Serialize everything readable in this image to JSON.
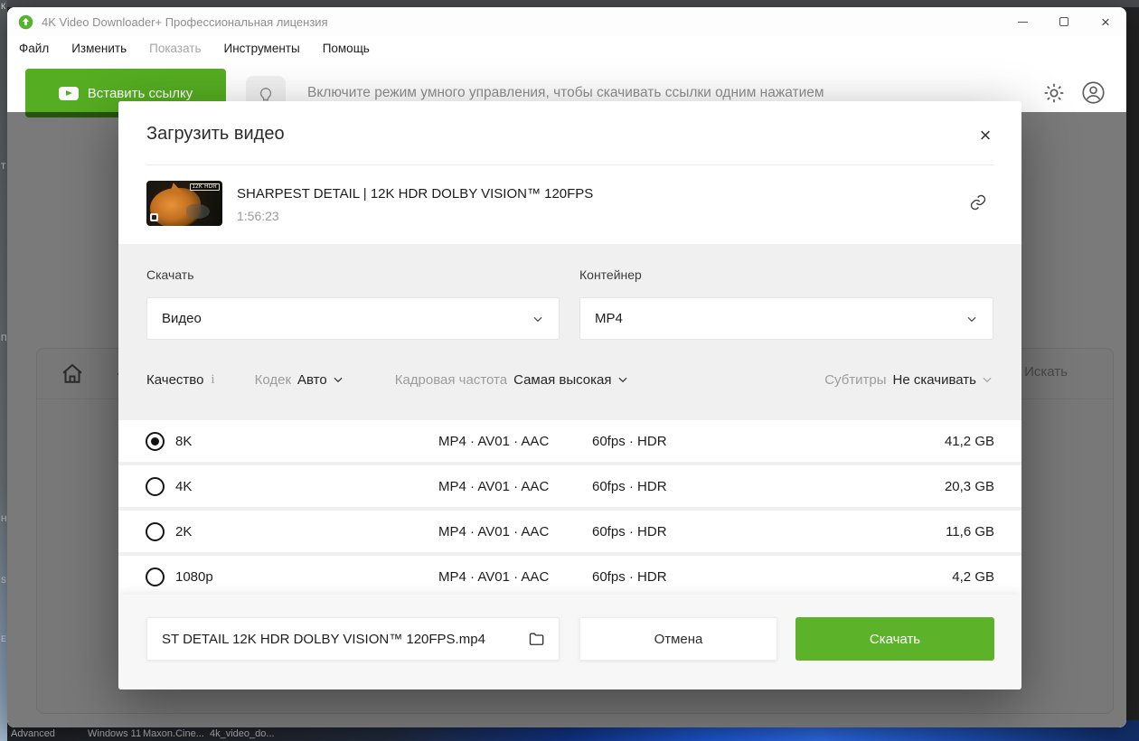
{
  "colors": {
    "accent_green": "#5cb32a",
    "dim_overlay": "rgba(0,0,0,0.52)",
    "body_gray": "#f0f0f0"
  },
  "desktop": {
    "edge_letters": [
      {
        "ch": "К"
      },
      {
        "ch": "Т"
      },
      {
        "ch": "П"
      },
      {
        "ch": "Н"
      },
      {
        "ch": "S"
      },
      {
        "ch": "Е"
      }
    ],
    "taskbar_labels": [
      {
        "label": "Advanced"
      },
      {
        "label": "Windows 11"
      },
      {
        "label": "Maxon.Cine..."
      },
      {
        "label": "4k_video_do..."
      }
    ]
  },
  "titlebar": {
    "app_title": "4K Video Downloader+ Профессиональная лицензия",
    "close_glyph": "×"
  },
  "menu": {
    "items": [
      {
        "label": "Файл",
        "disabled": false
      },
      {
        "label": "Изменить",
        "disabled": false
      },
      {
        "label": "Показать",
        "disabled": true
      },
      {
        "label": "Инструменты",
        "disabled": false
      },
      {
        "label": "Помощь",
        "disabled": false
      }
    ]
  },
  "toolbar": {
    "paste_link_button": "Вставить ссылку",
    "smart_mode_hint": "Включите режим умного управления, чтобы скачивать ссылки одним нажатием"
  },
  "main_view": {
    "search_button": "Искать"
  },
  "dialog": {
    "title": "Загрузить видео",
    "close_glyph": "×",
    "video": {
      "title": "SHARPEST DETAIL | 12K HDR DOLBY VISION™ 120FPS",
      "duration": "1:56:23",
      "thumb_badge": "12K HDR"
    },
    "download_label": "Скачать",
    "download_value": "Видео",
    "container_label": "Контейнер",
    "container_value": "MP4",
    "filters": {
      "quality_label": "Качество",
      "info_glyph": "i",
      "codec_label": "Кодек",
      "codec_value": "Авто",
      "framerate_label": "Кадровая частота",
      "framerate_value": "Самая высокая",
      "subtitles_label": "Субтитры",
      "subtitles_value": "Не скачивать"
    },
    "options": [
      {
        "label": "8K",
        "format": "MP4 · AV01 · AAC",
        "fps": "60fps · HDR",
        "size": "41,2 GB",
        "selected": true
      },
      {
        "label": "4K",
        "format": "MP4 · AV01 · AAC",
        "fps": "60fps · HDR",
        "size": "20,3 GB",
        "selected": false
      },
      {
        "label": "2K",
        "format": "MP4 · AV01 · AAC",
        "fps": "60fps · HDR",
        "size": "11,6 GB",
        "selected": false
      },
      {
        "label": "1080p",
        "format": "MP4 · AV01 · AAC",
        "fps": "60fps · HDR",
        "size": "4,2 GB",
        "selected": false
      }
    ],
    "filename": "ST DETAIL  12K HDR DOLBY VISION™ 120FPS.mp4",
    "cancel_button": "Отмена",
    "download_button": "Скачать"
  }
}
